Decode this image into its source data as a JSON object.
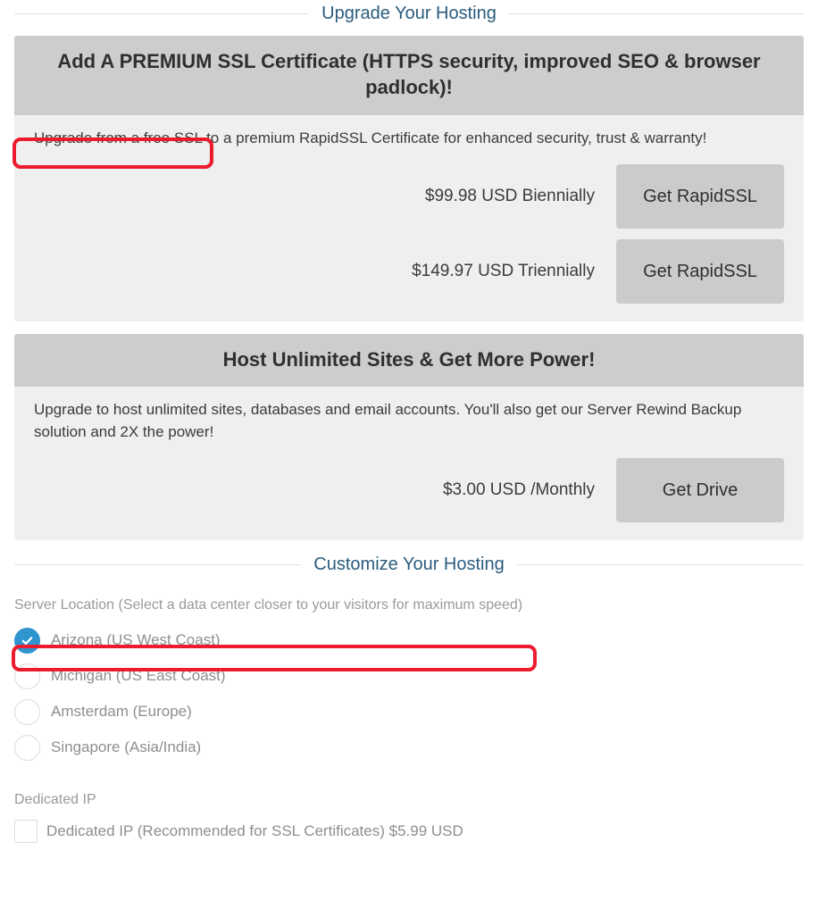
{
  "sections": {
    "upgrade_heading": "Upgrade Your Hosting",
    "customize_heading": "Customize Your Hosting"
  },
  "ssl_card": {
    "title": "Add A PREMIUM SSL Certificate (HTTPS security, improved SEO & browser padlock)!",
    "description": "Upgrade from a free SSL to a premium RapidSSL Certificate for enhanced security, trust & warranty!",
    "description_highlighted_part": "Upgrade from a free SSL",
    "offers": [
      {
        "price": "$99.98 USD Biennially",
        "button": "Get RapidSSL"
      },
      {
        "price": "$149.97 USD Triennially",
        "button": "Get RapidSSL"
      }
    ]
  },
  "drive_card": {
    "title": "Host Unlimited Sites & Get More Power!",
    "description": "Upgrade to host unlimited sites, databases and email accounts. You'll also get our Server Rewind Backup solution and 2X the power!",
    "offers": [
      {
        "price": "$3.00 USD /Monthly",
        "button": "Get Drive"
      }
    ]
  },
  "server_location": {
    "label": "Server Location (Select a data center closer to your visitors for maximum speed)",
    "options": [
      {
        "label": "Arizona (US West Coast)",
        "selected": true
      },
      {
        "label": "Michigan (US East Coast)",
        "selected": false
      },
      {
        "label": "Amsterdam (Europe)",
        "selected": false
      },
      {
        "label": "Singapore (Asia/India)",
        "selected": false
      }
    ]
  },
  "dedicated_ip": {
    "group_label": "Dedicated IP",
    "option_label": "Dedicated IP (Recommended for SSL Certificates) $5.99 USD",
    "checked": false
  },
  "colors": {
    "heading": "#2b5c7e",
    "card_header_bg": "#cdcdcd",
    "card_body_bg": "#efefef",
    "button_bg": "#cbcbcb",
    "radio_selected": "#2e95cf",
    "highlight_border": "#ec1c2e"
  }
}
